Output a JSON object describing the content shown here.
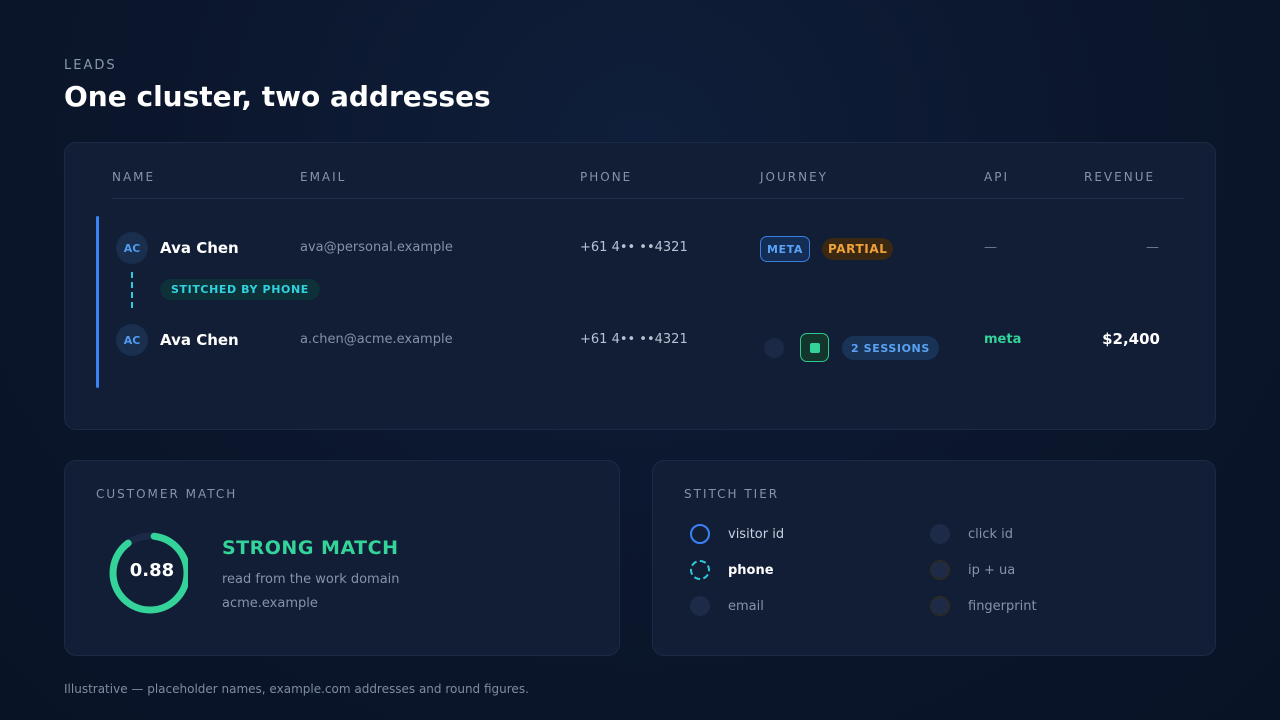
{
  "header": {
    "eyebrow": "LEADS",
    "title": "One cluster, two addresses"
  },
  "table": {
    "columns": [
      "NAME",
      "EMAIL",
      "PHONE",
      "JOURNEY",
      "API",
      "REVENUE"
    ],
    "rows": [
      {
        "initials": "AC",
        "name": "Ava Chen",
        "email": "ava@personal.example",
        "phone": "+61 4•• ••4321",
        "journey_tag": "META",
        "journey_status": "PARTIAL",
        "api": "—",
        "revenue": "—"
      },
      {
        "initials": "AC",
        "name": "Ava Chen",
        "email": "a.chen@acme.example",
        "phone": "+61 4•• ••4321",
        "sessions": "2 SESSIONS",
        "api": "meta",
        "revenue": "$2,400"
      }
    ],
    "stitch_label": "STITCHED BY PHONE"
  },
  "customer_match": {
    "label": "CUSTOMER MATCH",
    "score": "0.88",
    "score_value": 0.88,
    "verdict": "STRONG MATCH",
    "description": "read from the work domain acme.example",
    "colors": {
      "ring": "#34d399",
      "track": "#1b2947"
    }
  },
  "stitch_tier": {
    "label": "STITCH TIER",
    "items": [
      {
        "label": "visitor id",
        "state": "ring-blue"
      },
      {
        "label": "phone",
        "state": "active-dashed"
      },
      {
        "label": "email",
        "state": "muted"
      },
      {
        "label": "click id",
        "state": "muted"
      },
      {
        "label": "ip + ua",
        "state": "muted-ring"
      },
      {
        "label": "fingerprint",
        "state": "muted-ring"
      }
    ]
  },
  "footer": {
    "note": "Illustrative — placeholder names, example.com addresses and round figures."
  },
  "colors": {
    "accent_blue": "#3b82f6",
    "accent_green": "#34d399",
    "accent_cyan": "#2fc9d9",
    "accent_orange": "#f0a23a",
    "card_bg": "#121d36"
  }
}
